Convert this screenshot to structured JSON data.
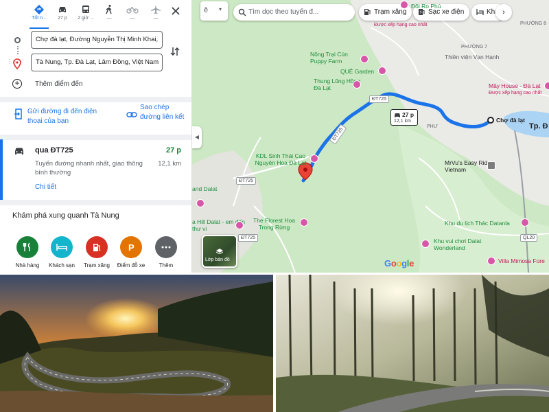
{
  "modes": [
    {
      "label": "Tốt n...",
      "icon": "directions-icon",
      "active": true
    },
    {
      "label": "27 p",
      "icon": "car-icon"
    },
    {
      "label": "2 giờ ...",
      "icon": "bus-icon"
    },
    {
      "label": "—",
      "icon": "walk-icon"
    },
    {
      "label": "—",
      "icon": "bike-icon"
    },
    {
      "label": "—",
      "icon": "plane-icon"
    }
  ],
  "origin": "Chợ đà lạt, Đường Nguyễn Thị Minh Khai,",
  "destination": "Tà Nung, Tp. Đà Lạt, Lâm Đồng, Việt Nam",
  "add_destination": "Thêm điểm đến",
  "send_to_phone": "Gửi đường đi đến điện thoại của bạn",
  "copy_link": "Sao chép đường liên kết",
  "route": {
    "via": "qua ĐT725",
    "duration": "27 p",
    "description": "Tuyến đường nhanh nhất, giao thông bình thường",
    "distance": "12,1 km",
    "details": "Chi tiết"
  },
  "explore": {
    "title": "Khám phá xung quanh Tà Nung",
    "categories": [
      {
        "label": "Nhà hàng",
        "color": "#188038"
      },
      {
        "label": "Khách sạn",
        "color": "#12b5cb"
      },
      {
        "label": "Trạm xăng",
        "color": "#d93025"
      },
      {
        "label": "Điểm đỗ xe",
        "color": "#e37400"
      },
      {
        "label": "Thêm",
        "color": "#5f6368"
      }
    ]
  },
  "map": {
    "search_placeholder": "Tìm dọc theo tuyến đ...",
    "chips": [
      "Trạm xăng",
      "Sạc xe điện",
      "Khá"
    ],
    "route_time": "27 p",
    "route_distance": "12,1 km",
    "layer_label": "Lớp bản đồ",
    "logo": "Google",
    "labels": {
      "doi_ro_phu": "Đồi Ro Phú",
      "top_rated": "Được xếp hạng cao nhất",
      "phuong8": "PHƯỜNG 8",
      "phuong7": "PHƯỜNG 7",
      "thien_vien": "Thiền viện Vạn Hạnh",
      "nong_trai": "Nông Trại Cún Puppy Farm",
      "que_garden": "QUÊ Garden",
      "thung_lung": "Thung Lũng Hồng Đà Lạt",
      "may_house": "Mây House - Đà Lạt",
      "may_sub": "Được xếp hạng cao nhất",
      "cho_da_lat": "Chợ đà lạt",
      "tp": "Tp. Đ",
      "phuong_short": "PHƯ",
      "kdl": "KDL Sinh Thái Cao Nguyên Hoa Đà Lạt",
      "mrvu": "MrVu's Easy Riders Vietnam",
      "and_dalat": "and Dalat",
      "hill_dalat": "a Hill Dalat - em đến thư vi",
      "florest": "The Florest Hoa Trong Rừng",
      "datanla": "Khu du lịch Thác Datanla",
      "wonderland": "Khu vui chơi Dalat Wonderland",
      "villa": "Villa Mimosa Fore",
      "roads": [
        "ĐT725",
        "ĐT725",
        "ĐT725",
        "QL20",
        "ĐT725"
      ]
    }
  },
  "photos": [
    {
      "name": "sunset-mountain-road-photo"
    },
    {
      "name": "pine-forest-road-photo"
    }
  ]
}
